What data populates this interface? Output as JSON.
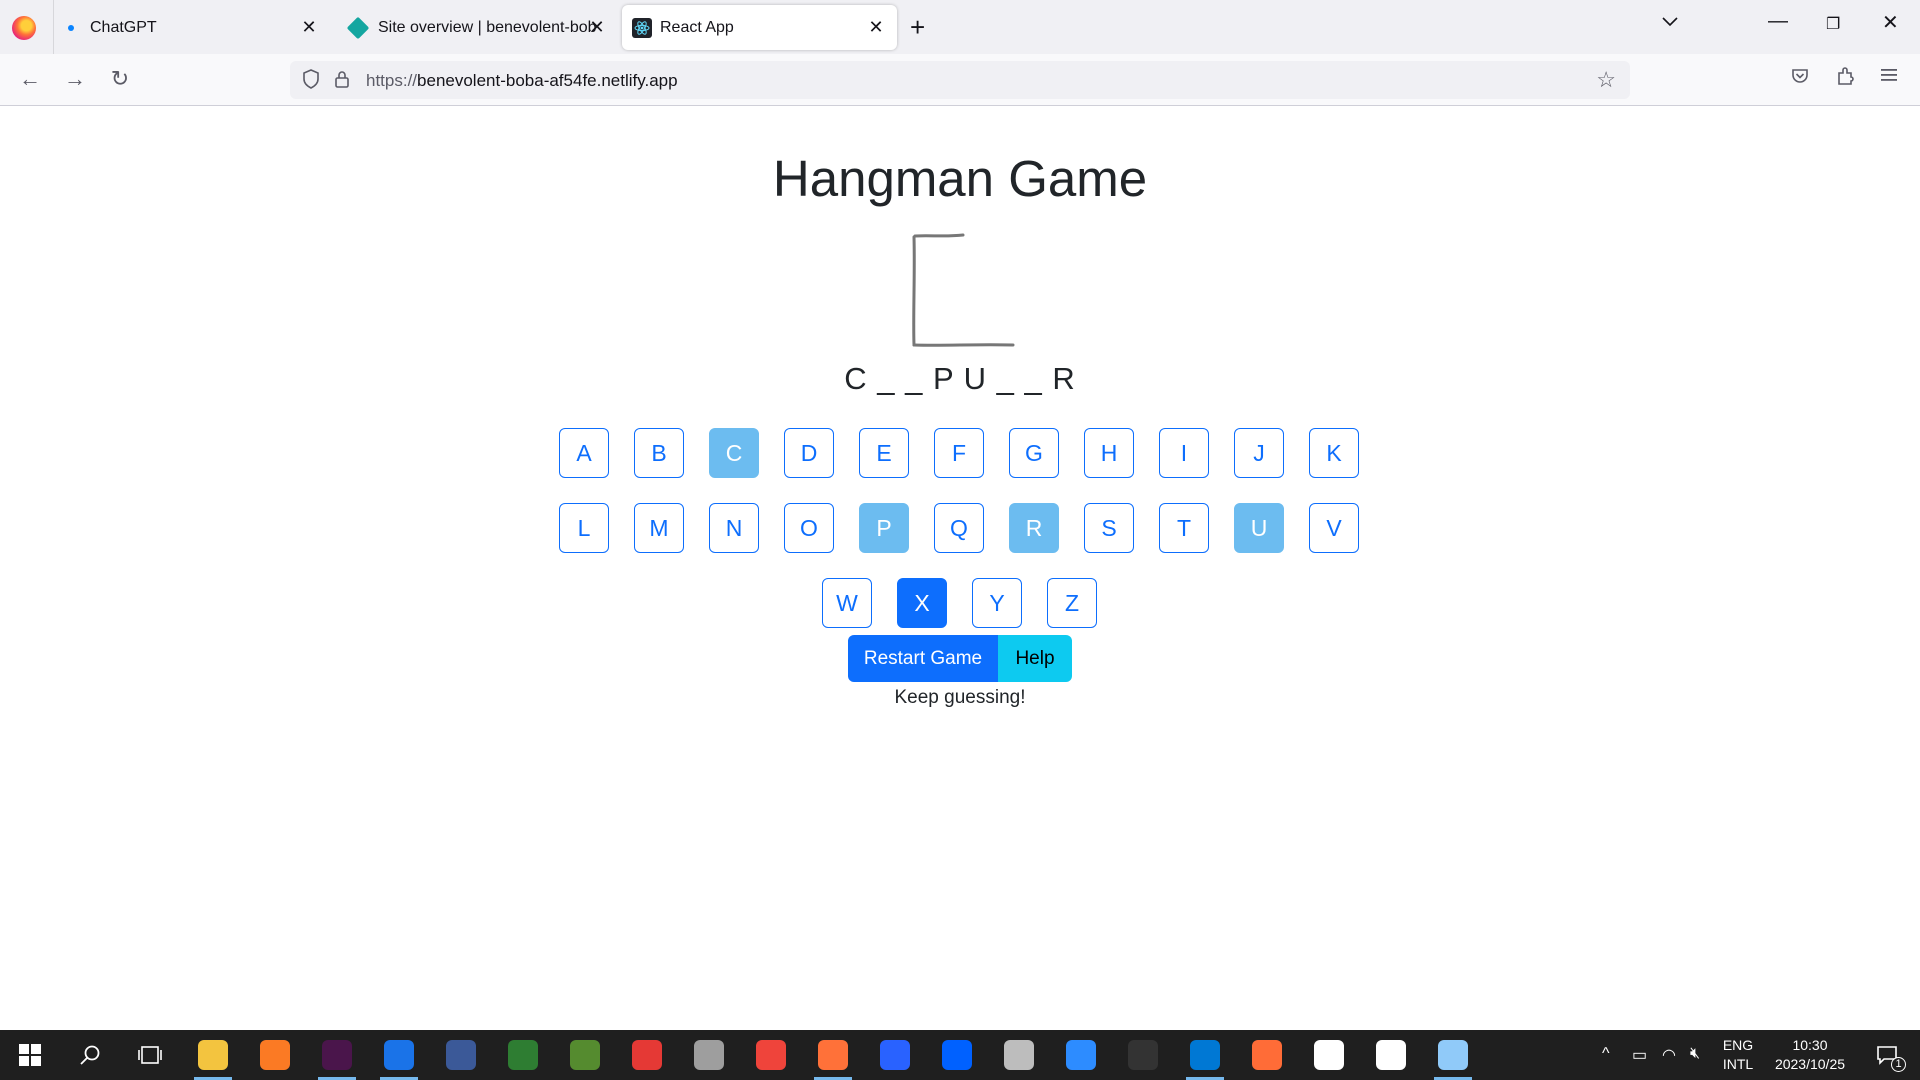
{
  "browser": {
    "tabs": [
      {
        "label": "ChatGPT",
        "icon": "dot-icon"
      },
      {
        "label": "Site overview | benevolent-bob",
        "icon": "netlify-icon"
      },
      {
        "label": "React App",
        "icon": "react-icon",
        "active": true
      }
    ],
    "url_prefix": "https://",
    "url_host": "benevolent-boba-af54fe.netlify.app"
  },
  "page": {
    "title": "Hangman Game",
    "word_display": "C _ _ P U _ _ R",
    "letters": [
      {
        "char": "A",
        "state": "unused"
      },
      {
        "char": "B",
        "state": "unused"
      },
      {
        "char": "C",
        "state": "guessed"
      },
      {
        "char": "D",
        "state": "unused"
      },
      {
        "char": "E",
        "state": "unused"
      },
      {
        "char": "F",
        "state": "unused"
      },
      {
        "char": "G",
        "state": "unused"
      },
      {
        "char": "H",
        "state": "unused"
      },
      {
        "char": "I",
        "state": "unused"
      },
      {
        "char": "J",
        "state": "unused"
      },
      {
        "char": "K",
        "state": "unused"
      },
      {
        "char": "L",
        "state": "unused"
      },
      {
        "char": "M",
        "state": "unused"
      },
      {
        "char": "N",
        "state": "unused"
      },
      {
        "char": "O",
        "state": "unused"
      },
      {
        "char": "P",
        "state": "guessed"
      },
      {
        "char": "Q",
        "state": "unused"
      },
      {
        "char": "R",
        "state": "guessed"
      },
      {
        "char": "S",
        "state": "unused"
      },
      {
        "char": "T",
        "state": "unused"
      },
      {
        "char": "U",
        "state": "guessed"
      },
      {
        "char": "V",
        "state": "unused"
      },
      {
        "char": "W",
        "state": "unused"
      },
      {
        "char": "X",
        "state": "selected"
      },
      {
        "char": "Y",
        "state": "unused"
      },
      {
        "char": "Z",
        "state": "unused"
      }
    ],
    "restart_label": "Restart Game",
    "help_label": "Help",
    "status": "Keep guessing!"
  },
  "taskbar": {
    "apps": [
      {
        "name": "file-explorer-icon",
        "color": "#f3c43f"
      },
      {
        "name": "xampp-icon",
        "color": "#fb7a24"
      },
      {
        "name": "slack-icon",
        "color": "#4a154b"
      },
      {
        "name": "chrome-icon",
        "color": "#1a73e8"
      },
      {
        "name": "app-icon",
        "color": "#3b5998"
      },
      {
        "name": "hs-icon",
        "color": "#2e7d32"
      },
      {
        "name": "app-icon",
        "color": "#558b2f"
      },
      {
        "name": "app-icon",
        "color": "#e53935"
      },
      {
        "name": "app-icon",
        "color": "#9e9e9e"
      },
      {
        "name": "anydesk-icon",
        "color": "#ef443b"
      },
      {
        "name": "firefox-icon",
        "color": "#ff7139"
      },
      {
        "name": "app-icon",
        "color": "#2962ff"
      },
      {
        "name": "dropbox-icon",
        "color": "#0061ff"
      },
      {
        "name": "swf-icon",
        "color": "#bdbdbd"
      },
      {
        "name": "zoom-icon",
        "color": "#2d8cff"
      },
      {
        "name": "terminal-icon",
        "color": "#333333"
      },
      {
        "name": "vscode-icon",
        "color": "#0078d4"
      },
      {
        "name": "postman-icon",
        "color": "#ff6c37"
      },
      {
        "name": "mongodb-icon",
        "color": "#ffffff"
      },
      {
        "name": "mongodb-compass-icon",
        "color": "#ffffff"
      },
      {
        "name": "app-icon",
        "color": "#90caf9"
      }
    ],
    "lang_line1": "ENG",
    "lang_line2": "INTL",
    "time": "10:30",
    "date": "2023/10/25",
    "notification_count": "1"
  }
}
